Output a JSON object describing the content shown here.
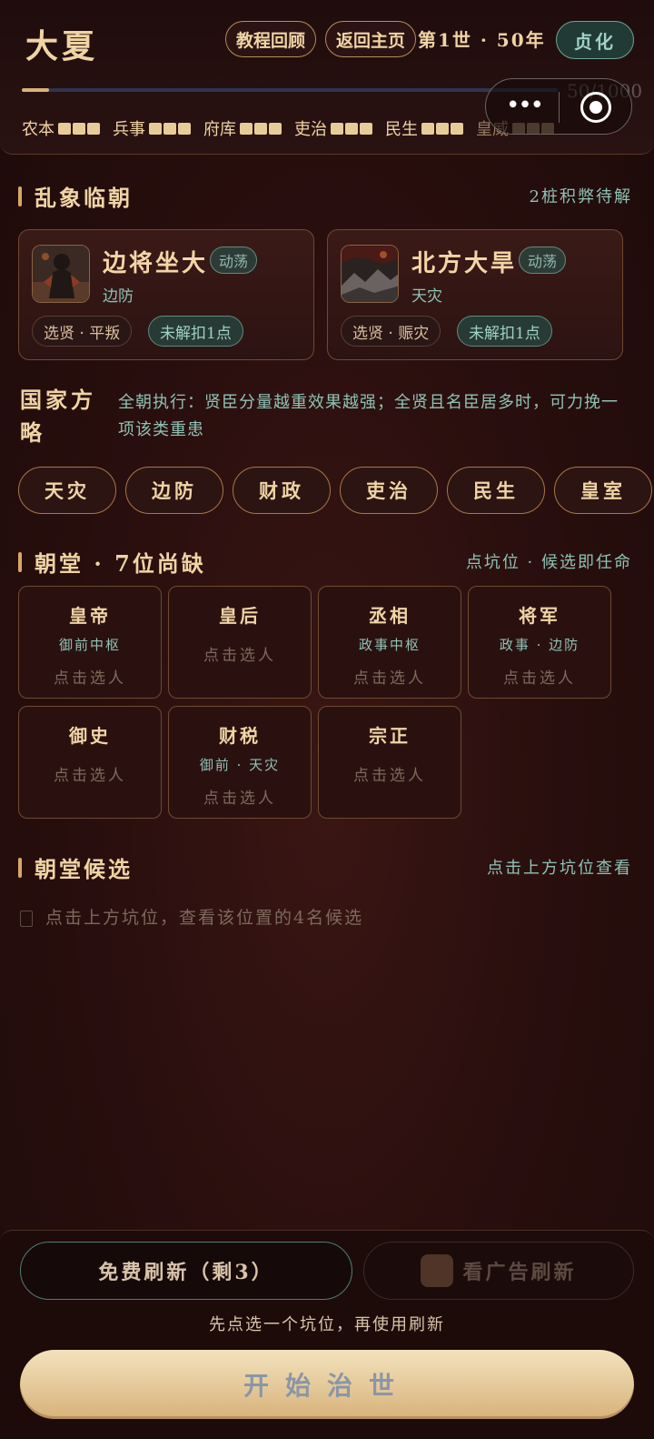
{
  "header": {
    "dynasty": "大夏",
    "tutorial_label": "教程回顾",
    "home_label": "返回主页",
    "era_text": "第1世 · 50年",
    "reign_label": "贞化",
    "progress_text": "50/1000",
    "progress_fraction": 0.05,
    "stats": [
      {
        "label": "农本",
        "level": 3
      },
      {
        "label": "兵事",
        "level": 3
      },
      {
        "label": "府库",
        "level": 3
      },
      {
        "label": "吏治",
        "level": 3
      },
      {
        "label": "民生",
        "level": 3
      },
      {
        "label": "皇威",
        "level": 3
      }
    ]
  },
  "crisis": {
    "title": "乱象临朝",
    "pending": "2桩积弊待解",
    "cards": [
      {
        "name": "边将坐大",
        "tag": "动荡",
        "category": "边防",
        "plan": "选贤 · 平叛",
        "cost": "未解扣1点",
        "icon": "general-portrait-icon"
      },
      {
        "name": "北方大旱",
        "tag": "动荡",
        "category": "天灾",
        "plan": "选贤 · 赈灾",
        "cost": "未解扣1点",
        "icon": "drought-landscape-icon"
      }
    ]
  },
  "strategy": {
    "label": "国家方略",
    "description": "全朝执行：贤臣分量越重效果越强；全贤且名臣居多时，可力挽一项该类重患",
    "options": [
      "天灾",
      "边防",
      "财政",
      "吏治",
      "民生",
      "皇室"
    ]
  },
  "court": {
    "title": "朝堂 · 7位尚缺",
    "note": "点坑位 · 候选即任命",
    "slots": [
      {
        "role": "皇帝",
        "req": "御前中枢",
        "pick": "点击选人"
      },
      {
        "role": "皇后",
        "req": "",
        "pick": "点击选人"
      },
      {
        "role": "丞相",
        "req": "政事中枢",
        "pick": "点击选人"
      },
      {
        "role": "将军",
        "req": "政事 · 边防",
        "pick": "点击选人"
      },
      {
        "role": "御史",
        "req": "",
        "pick": "点击选人"
      },
      {
        "role": "财税",
        "req": "御前 · 天灾",
        "pick": "点击选人"
      },
      {
        "role": "宗正",
        "req": "",
        "pick": "点击选人"
      }
    ]
  },
  "candidates": {
    "title": "朝堂候选",
    "note": "点击上方坑位查看",
    "hint": "点击上方坑位，查看该位置的4名候选"
  },
  "bottom": {
    "free_refresh": "免费刷新（剩3）",
    "ad_refresh": "看广告刷新",
    "refresh_hint": "先点选一个坑位，再使用刷新",
    "start": "开始治世"
  }
}
